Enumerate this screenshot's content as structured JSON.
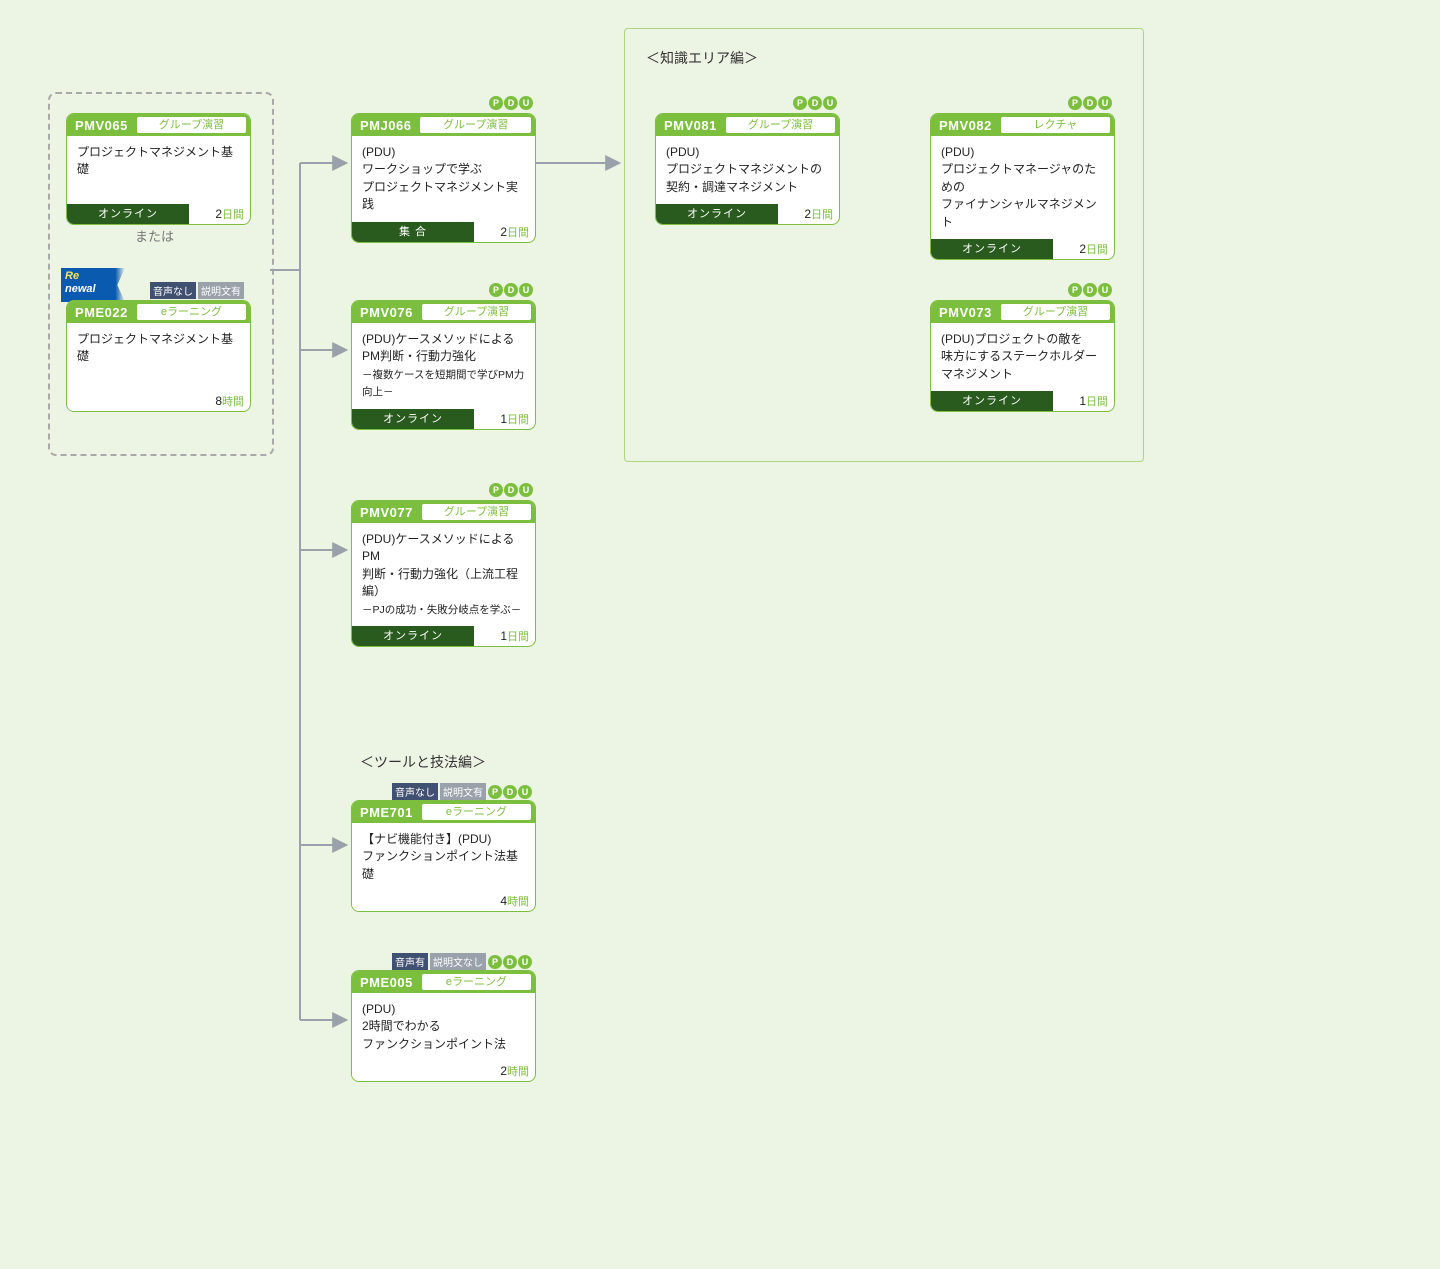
{
  "connector_label": "または",
  "groups": {
    "knowledge": {
      "title": "＜知識エリア編＞"
    },
    "tools": {
      "title": "＜ツールと技法編＞"
    }
  },
  "renewal": {
    "line1": "Re",
    "line2": "newal"
  },
  "badges": {
    "pdu": [
      "P",
      "D",
      "U"
    ],
    "onsei_nashi": "音声なし",
    "setsumei_ari": "説明文有",
    "onsei_ari": "音声有",
    "setsumei_nashi": "説明文なし"
  },
  "cards": {
    "pmv065": {
      "code": "PMV065",
      "type": "グループ演習",
      "title": "プロジェクトマネジメント基礎",
      "delivery": "オンライン",
      "dur_num": "2",
      "dur_unit": "日間"
    },
    "pme022": {
      "code": "PME022",
      "type": "eラーニング",
      "title": "プロジェクトマネジメント基礎",
      "dur_num": "8",
      "dur_unit": "時間"
    },
    "pmj066": {
      "code": "PMJ066",
      "type": "グループ演習",
      "title_l1": "(PDU)",
      "title_l2": "ワークショップで学ぶ",
      "title_l3": "プロジェクトマネジメント実践",
      "delivery": "集 合",
      "dur_num": "2",
      "dur_unit": "日間"
    },
    "pmv076": {
      "code": "PMV076",
      "type": "グループ演習",
      "title_l1": "(PDU)ケースメソッドによる",
      "title_l2": "PM判断・行動力強化",
      "title_l3": "－複数ケースを短期間で学びPM力向上－",
      "delivery": "オンライン",
      "dur_num": "1",
      "dur_unit": "日間"
    },
    "pmv077": {
      "code": "PMV077",
      "type": "グループ演習",
      "title_l1": "(PDU)ケースメソッドによるPM",
      "title_l2": "判断・行動力強化（上流工程編）",
      "title_l3": "－PJの成功・失敗分岐点を学ぶ－",
      "delivery": "オンライン",
      "dur_num": "1",
      "dur_unit": "日間"
    },
    "pme701": {
      "code": "PME701",
      "type": "eラーニング",
      "title_l1": "【ナビ機能付き】(PDU)",
      "title_l2": "ファンクションポイント法基礎",
      "dur_num": "4",
      "dur_unit": "時間"
    },
    "pme005": {
      "code": "PME005",
      "type": "eラーニング",
      "title_l1": "(PDU)",
      "title_l2": "2時間でわかる",
      "title_l3": "ファンクションポイント法",
      "dur_num": "2",
      "dur_unit": "時間"
    },
    "pmv081": {
      "code": "PMV081",
      "type": "グループ演習",
      "title_l1": "(PDU)",
      "title_l2": "プロジェクトマネジメントの",
      "title_l3": "契約・調達マネジメント",
      "delivery": "オンライン",
      "dur_num": "2",
      "dur_unit": "日間"
    },
    "pmv082": {
      "code": "PMV082",
      "type": "レクチャ",
      "title_l1": "(PDU)",
      "title_l2": "プロジェクトマネージャのための",
      "title_l3": "ファイナンシャルマネジメント",
      "delivery": "オンライン",
      "dur_num": "2",
      "dur_unit": "日間"
    },
    "pmv073": {
      "code": "PMV073",
      "type": "グループ演習",
      "title_l1": "(PDU)プロジェクトの敵を",
      "title_l2": "味方にするステークホルダー",
      "title_l3": "マネジメント",
      "delivery": "オンライン",
      "dur_num": "1",
      "dur_unit": "日間"
    }
  }
}
